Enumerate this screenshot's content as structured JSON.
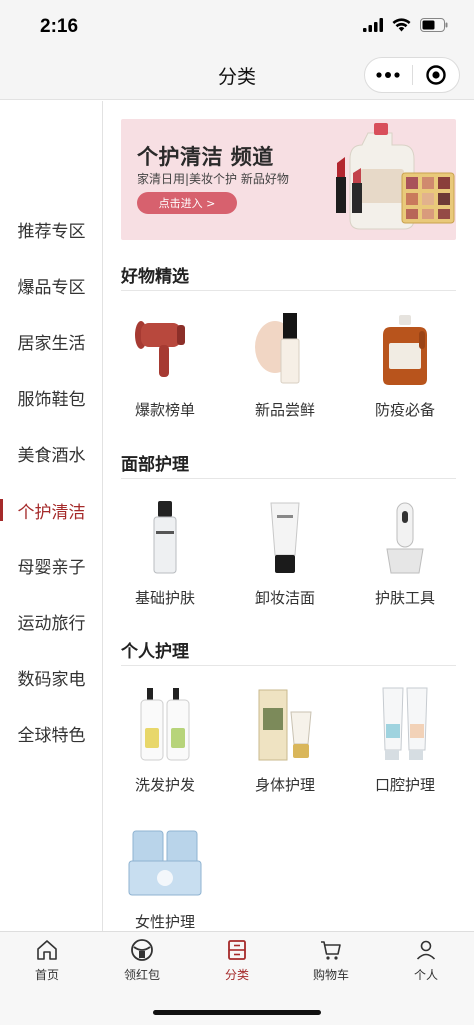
{
  "status_bar": {
    "time": "2:16"
  },
  "nav": {
    "title": "分类",
    "more_icon": "more-dots-icon",
    "close_icon": "target-close-icon"
  },
  "sidebar": {
    "items": [
      {
        "label": "推荐专区"
      },
      {
        "label": "爆品专区"
      },
      {
        "label": "居家生活"
      },
      {
        "label": "服饰鞋包"
      },
      {
        "label": "美食酒水"
      },
      {
        "label": "个护清洁",
        "active": true
      },
      {
        "label": "母婴亲子"
      },
      {
        "label": "运动旅行"
      },
      {
        "label": "数码家电"
      },
      {
        "label": "全球特色"
      }
    ],
    "active_color": "#a52a2a"
  },
  "banner": {
    "title": "个护清洁 频道",
    "subtitle": "家清日用|美妆个护 新品好物",
    "button": "点击进入 >"
  },
  "sections": [
    {
      "title": "好物精选",
      "items": [
        {
          "label": "爆款榜单",
          "icon": "hair-dryer"
        },
        {
          "label": "新品尝鲜",
          "icon": "foundation-bottle"
        },
        {
          "label": "防疫必备",
          "icon": "disinfectant-bottle"
        }
      ]
    },
    {
      "title": "面部护理",
      "items": [
        {
          "label": "基础护肤",
          "icon": "toner-bottle"
        },
        {
          "label": "卸妆洁面",
          "icon": "cleanser-tube"
        },
        {
          "label": "护肤工具",
          "icon": "beauty-device"
        }
      ]
    },
    {
      "title": "个人护理",
      "items": [
        {
          "label": "洗发护发",
          "icon": "shampoo-bottles"
        },
        {
          "label": "身体护理",
          "icon": "hand-cream"
        },
        {
          "label": "口腔护理",
          "icon": "toothpaste-tubes"
        },
        {
          "label": "女性护理",
          "icon": "sanitary-pad-packs"
        }
      ]
    }
  ],
  "tab_bar": {
    "items": [
      {
        "label": "首页",
        "icon": "home-icon"
      },
      {
        "label": "领红包",
        "icon": "red-packet-icon"
      },
      {
        "label": "分类",
        "icon": "category-icon",
        "active": true
      },
      {
        "label": "购物车",
        "icon": "cart-icon"
      },
      {
        "label": "个人",
        "icon": "user-icon"
      }
    ]
  }
}
